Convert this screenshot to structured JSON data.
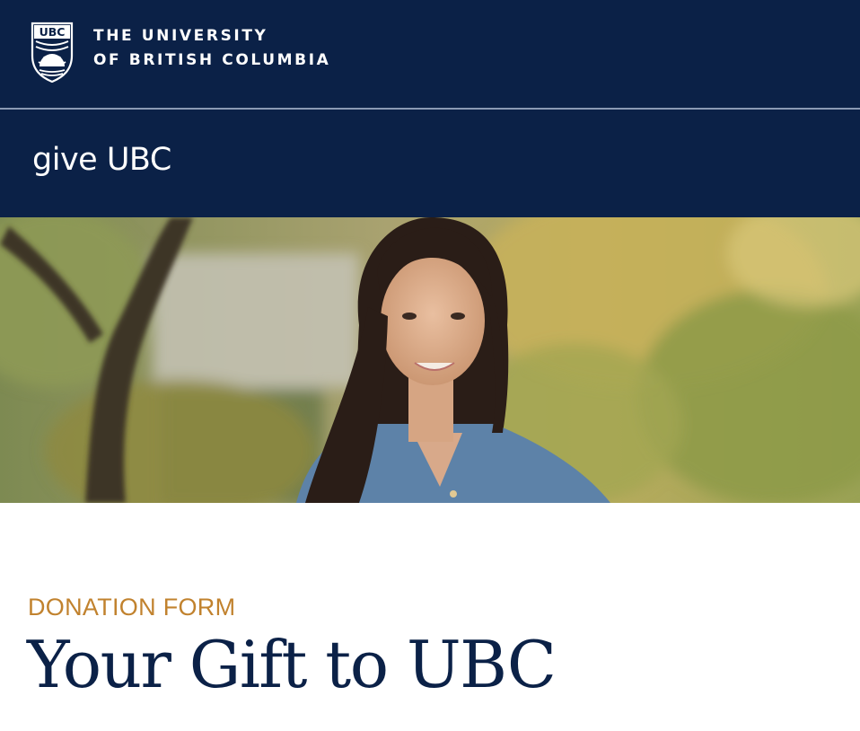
{
  "header": {
    "logo_alt": "UBC",
    "university_line1": "THE UNIVERSITY",
    "university_line2": "OF BRITISH COLUMBIA",
    "site_title": "give UBC"
  },
  "hero": {
    "image": "portrait-photo"
  },
  "main": {
    "eyebrow": "DONATION FORM",
    "title": "Your Gift to UBC"
  },
  "colors": {
    "navy": "#0b2147",
    "accent": "#c1822e",
    "divider": "#8b9ab4"
  }
}
